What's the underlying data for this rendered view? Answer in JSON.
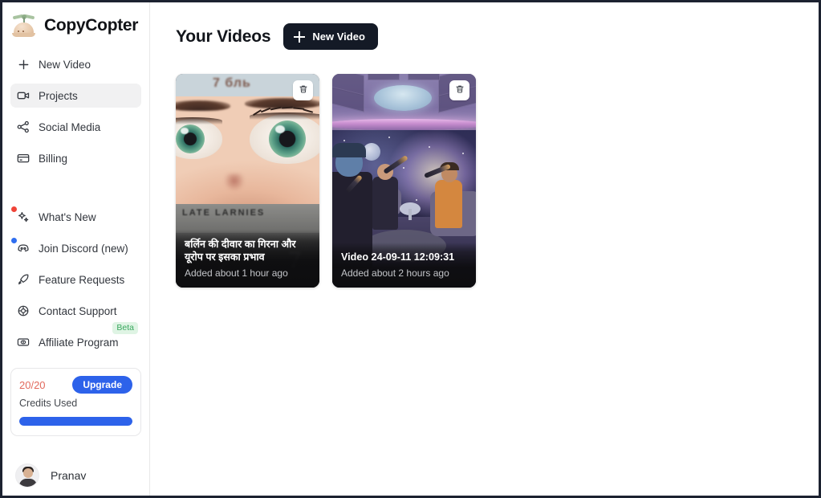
{
  "brand": {
    "name": "CopyCopter",
    "logo_icon": "propeller-beanie-icon"
  },
  "sidebar": {
    "primary_items": [
      {
        "label": "New Video",
        "icon": "plus-icon",
        "active": false
      },
      {
        "label": "Projects",
        "icon": "video-camera-icon",
        "active": true
      },
      {
        "label": "Social Media",
        "icon": "share-network-icon",
        "active": false
      },
      {
        "label": "Billing",
        "icon": "credit-card-icon",
        "active": false
      }
    ],
    "secondary_items": [
      {
        "label": "What's New",
        "icon": "sparkles-icon",
        "dot": "red",
        "dot_color": "#f04438"
      },
      {
        "label": "Join Discord (new)",
        "icon": "discord-icon",
        "dot": "blue",
        "dot_color": "#2f6ef0"
      },
      {
        "label": "Feature Requests",
        "icon": "rocket-icon"
      },
      {
        "label": "Contact Support",
        "icon": "lifebuoy-icon"
      },
      {
        "label": "Affiliate Program",
        "icon": "eye-card-icon",
        "badge": "Beta"
      }
    ],
    "credits": {
      "count": "20/20",
      "label": "Credits Used",
      "upgrade_label": "Upgrade",
      "progress_percent": 100,
      "count_color": "#e2695c",
      "accent_color": "#2d62ea"
    },
    "user": {
      "name": "Pranav",
      "avatar_icon": "user-avatar"
    }
  },
  "main": {
    "title": "Your Videos",
    "new_video_button": "New Video",
    "videos": [
      {
        "title": "बर्लिन की दीवार का गिरना और यूरोप पर इसका प्रभाव",
        "added": "Added about 1 hour ago",
        "delete_icon": "trash-icon",
        "thumb_top_text": "7 бль",
        "thumb_mid_text": "LATE LARNIES"
      },
      {
        "title": "Video 24-09-11 12:09:31",
        "added": "Added about 2 hours ago",
        "delete_icon": "trash-icon"
      }
    ]
  }
}
